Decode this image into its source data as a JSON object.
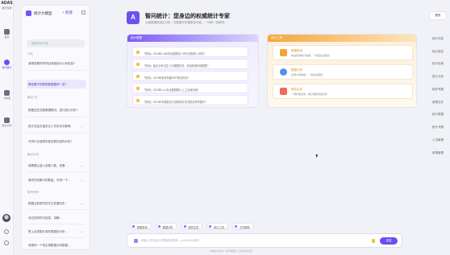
{
  "app": {
    "logo_text": "ADAS",
    "logo_sub": "统计专家"
  },
  "rail": {
    "items": [
      {
        "label": "首页"
      },
      {
        "label": "智问统计"
      },
      {
        "label": "AI数据"
      },
      {
        "label": "报表文库"
      }
    ]
  },
  "sidebar": {
    "title": "统计大模型",
    "new_label": "+ 新建",
    "search_placeholder": "搜索历史记录",
    "groups": [
      "今天",
      "最近7天",
      "最近30天",
      "更早时间"
    ],
    "items": [
      "我想查看所有项目或者统计公司信息?",
      "帮给看不同类型数据整体一览?",
      "根据这些总数数据概况，进行统计分析?",
      "统计总结去重多名人员来访次数等...",
      "不同行业接受年度总数的结构分布?",
      "我需要让接入查看人数，查看...",
      "各研究成果中的数量，评测一下...",
      "根据当前研究的中文发展历史...",
      "对应的研究中信息，讲解...",
      "帮上此类图片类的数据处分析...",
      "请提供一个地生物数据分析数据...",
      "根据这些图片的需要分析，接入..."
    ]
  },
  "hero": {
    "icon_text": "A",
    "title": "智问统计：您身边的权威统计专家",
    "subtitle": "大量数据和真实分析，在数据中发掘更多可能，一问就一答案来。"
  },
  "left_card": {
    "title": "统计数据",
    "questions": [
      "「查询」2024年1-6月份全国居民人均可支配收入情况?",
      "「查询」最近五年出生人口数据情况，并绘制成折线图表?",
      "「查询」2024年各省年度GDP排名情况?",
      "「查询」2024年1-10月全国规模以上工业增加值?",
      "「查询」2024年中国进出口总额增长情况是否有所提升?"
    ]
  },
  "right_card": {
    "title": "统计工具",
    "tools": [
      {
        "name": "数据查询",
        "desc": "快速查询统计数据，一键直接出图表",
        "color": "#f2a43a"
      },
      {
        "name": "数据分析",
        "desc": "多维分析数据，一键生成报告",
        "color": "#5b8def"
      },
      {
        "name": "报告生成",
        "desc": "一键智能生成，统计报告快速写作",
        "color": "#f06a5b"
      }
    ]
  },
  "chips": [
    "数据查询",
    "数据分析",
    "报告生成",
    "统计工具",
    "文件解析"
  ],
  "input": {
    "placeholder": "请输入您的统计问题或者需求，shift+enter换行",
    "send_label": "发送",
    "disclaimer": "内容由AI生成，请仔细甄别，仅供参考使用"
  },
  "right_rail": {
    "items": [
      "首页",
      "统计问答",
      "统计报告",
      "统计检索",
      "统计分析",
      "相关专题",
      "政策文件",
      "统计数据",
      "统计专题",
      "人员管理",
      "政策管理"
    ]
  }
}
